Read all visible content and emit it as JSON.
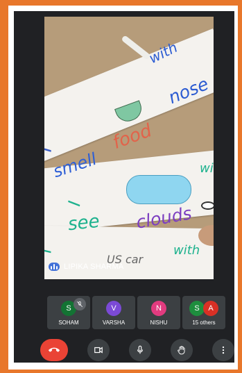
{
  "main_video": {
    "speaker_name": "LIPIKA SHARMA",
    "pin_icon": "pin-icon",
    "speaking_icon": "audio-bars-icon",
    "whiteboard_words": {
      "i_1": "I",
      "smell": "smell",
      "food": "food",
      "nose": "nose",
      "with_1": "with",
      "i_2": "I",
      "see": "see",
      "clouds": "clouds",
      "with_2": "with",
      "i_3": "I",
      "uscar": "US car",
      "with_3": "with"
    }
  },
  "participants": [
    {
      "initial": "S",
      "name": "SOHAM",
      "color": "#137333",
      "muted": true
    },
    {
      "initial": "V",
      "name": "VARSHA",
      "color": "#7b4ad6"
    },
    {
      "initial": "N",
      "name": "NISHU",
      "color": "#e23b7f"
    },
    {
      "initial": "S",
      "initial2": "A",
      "name": "15 others",
      "color": "#1e8e3e",
      "color2": "#d93025"
    }
  ],
  "controls": {
    "end_call": "end-call-icon",
    "camera": "camera-icon",
    "microphone": "microphone-icon",
    "raise_hand": "hand-icon",
    "more": "more-vert-icon"
  },
  "colors": {
    "background_border": "#e8772b",
    "call_background": "#202124",
    "tile_background": "#3c4043",
    "end_call": "#ea4335"
  }
}
